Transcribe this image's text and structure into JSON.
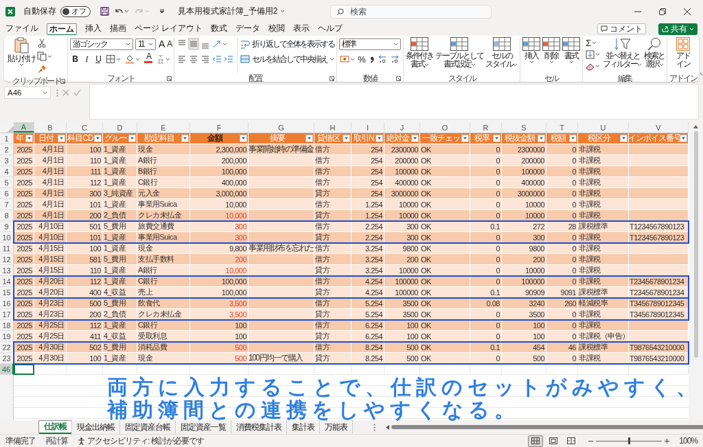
{
  "titlebar": {
    "autosave_label": "自動保存",
    "autosave_state": "オフ",
    "autosave_on": false,
    "filename": "見本用複式家計簿_予備用2",
    "search_placeholder": "検索"
  },
  "menu": [
    {
      "label": "ファイル",
      "selected": false
    },
    {
      "label": "ホーム",
      "selected": true
    },
    {
      "label": "挿入",
      "selected": false
    },
    {
      "label": "描画",
      "selected": false
    },
    {
      "label": "ページ レイアウト",
      "selected": false
    },
    {
      "label": "数式",
      "selected": false
    },
    {
      "label": "データ",
      "selected": false
    },
    {
      "label": "校閲",
      "selected": false
    },
    {
      "label": "表示",
      "selected": false
    },
    {
      "label": "ヘルプ",
      "selected": false
    }
  ],
  "comment_button": "コメント",
  "share_button": "共有",
  "ribbon": {
    "clipboard": {
      "paste": "貼り付け",
      "label": "クリップボード"
    },
    "font": {
      "name": "游ゴシック",
      "size": "11",
      "grow": "A",
      "shrink": "A",
      "bold": "B",
      "italic": "I",
      "underline": "U",
      "font_color_letter": "A",
      "label": "フォント"
    },
    "alignment": {
      "wrap": "折り返して全体を表示する",
      "merge": "セルを結合して中央揃え",
      "label": "配置"
    },
    "number": {
      "format": "標準",
      "percent": "%",
      "label": "数値"
    },
    "styles": {
      "conditional": [
        "条件付き",
        "書式"
      ],
      "table": [
        "テーブルとして",
        "書式設定"
      ],
      "cell_styles": [
        "セルの",
        "スタイル"
      ],
      "label": "スタイル"
    },
    "cells": {
      "insert": "挿入",
      "delete": "削除",
      "format": "書式",
      "label": "セル"
    },
    "editing": {
      "autosum": "Σ",
      "sort": [
        "並べ替えと",
        "フィルター"
      ],
      "find": [
        "検索と",
        "選択"
      ],
      "label": "編集"
    },
    "addins": {
      "addin": [
        "アド",
        "イン"
      ],
      "label": "アドイン"
    }
  },
  "name_box": "A46",
  "sheet": {
    "columns": [
      "A",
      "B",
      "C",
      "D",
      "E",
      "F",
      "G",
      "H",
      "I",
      "J",
      "O",
      "R",
      "S",
      "T",
      "U",
      "V"
    ],
    "header_row": {
      "num": "1",
      "cells": [
        {
          "text": "年",
          "emphasis": false
        },
        {
          "text": "日付",
          "emphasis": false
        },
        {
          "text": "科目CD",
          "emphasis": false
        },
        {
          "text": "グルー",
          "emphasis": false
        },
        {
          "text": "勘定科目",
          "emphasis": false
        },
        {
          "text": "金額",
          "emphasis": true
        },
        {
          "text": "摘要",
          "emphasis": false
        },
        {
          "text": "貸借区",
          "emphasis": false
        },
        {
          "text": "取引N",
          "emphasis": false
        },
        {
          "text": "絶対金",
          "emphasis": false
        },
        {
          "text": "一致チェッ",
          "emphasis": false
        },
        {
          "text": "税率",
          "emphasis": false
        },
        {
          "text": "税抜金額",
          "emphasis": false
        },
        {
          "text": "税額",
          "emphasis": false
        },
        {
          "text": "税区分",
          "emphasis": false
        },
        {
          "text": "インボイス番号",
          "emphasis": false
        }
      ]
    },
    "blocks": [
      {
        "boxed": false,
        "rows": [
          {
            "num": "2",
            "red": false,
            "cells": [
              "2025",
              "4月1日",
              "100",
              "1_資産",
              "現金",
              "2,300,000",
              "事業開始時の準備金",
              "借方",
              "254",
              "2300000",
              "OK",
              "0",
              "2300000",
              "0",
              "非課税",
              null
            ]
          },
          {
            "num": "3",
            "red": false,
            "cells": [
              "2025",
              "4月1日",
              "110",
              "1_資産",
              "A銀行",
              "200,000",
              null,
              "借方",
              "254",
              "200000",
              "OK",
              "0",
              "200000",
              "0",
              "非課税",
              null
            ]
          },
          {
            "num": "4",
            "red": false,
            "cells": [
              "2025",
              "4月1日",
              "111",
              "1_資産",
              "B銀行",
              "100,000",
              null,
              "借方",
              "254",
              "100000",
              "OK",
              "0",
              "100000",
              "0",
              "非課税",
              null
            ]
          },
          {
            "num": "5",
            "red": false,
            "cells": [
              "2025",
              "4月1日",
              "112",
              "1_資産",
              "C銀行",
              "400,000",
              null,
              "借方",
              "254",
              "400000",
              "OK",
              "0",
              "400000",
              "0",
              "非課税",
              null
            ]
          },
          {
            "num": "6",
            "red": false,
            "cells": [
              "2025",
              "4月1日",
              "300",
              "3_純資産",
              "元入金",
              "3,000,000",
              null,
              "貸方",
              "254",
              "3000000",
              "OK",
              "0",
              "3000000",
              "0",
              "非課税",
              null
            ]
          },
          {
            "num": "7",
            "red": false,
            "cells": [
              "2025",
              "4月1日",
              "101",
              "1_資産",
              "事業用Suica",
              "10,000",
              null,
              "借方",
              "1.254",
              "10000",
              "OK",
              "0",
              "10000",
              "0",
              "非課税",
              null
            ]
          },
          {
            "num": "8",
            "red": true,
            "cells": [
              "2025",
              "4月1日",
              "200",
              "2_負債",
              "クレカ未払金",
              "10,000",
              null,
              "貸方",
              "1.254",
              "10000",
              "OK",
              "0",
              "10000",
              "0",
              "非課税",
              null
            ]
          }
        ]
      },
      {
        "boxed": true,
        "rows": [
          {
            "num": "9",
            "red": true,
            "cells": [
              "2025",
              "4月10日",
              "501",
              "5_費用",
              "旅費交通費",
              "300",
              null,
              "借方",
              "2.254",
              "300",
              "OK",
              "0.1",
              "272",
              "28",
              "課税標準",
              "T1234567890123"
            ]
          },
          {
            "num": "10",
            "red": true,
            "cells": [
              "2025",
              "4月10日",
              "101",
              "1_資産",
              "事業用Suica",
              "300",
              null,
              "貸方",
              "2.254",
              "300",
              "OK",
              "0",
              "300",
              "0",
              "非課税",
              "T1234567890123"
            ]
          }
        ]
      },
      {
        "boxed": false,
        "rows": [
          {
            "num": "11",
            "red": false,
            "cells": [
              "2025",
              "4月15日",
              "100",
              "1_資産",
              "現金",
              "9,800",
              "事業用財布を忘れた",
              "借方",
              "3.254",
              "9800",
              "OK",
              "0",
              "9800",
              "0",
              "非課税",
              null
            ]
          },
          {
            "num": "12",
            "red": true,
            "cells": [
              "2025",
              "4月15日",
              "581",
              "5_費用",
              "支払手数料",
              "200",
              null,
              "借方",
              "3.254",
              "200",
              "OK",
              "0",
              "200",
              "0",
              "非課税",
              null
            ]
          },
          {
            "num": "13",
            "red": true,
            "cells": [
              "2025",
              "4月15日",
              "110",
              "1_資産",
              "A銀行",
              "10,000",
              null,
              "貸方",
              "3.254",
              "10000",
              "OK",
              "0",
              "10000",
              "0",
              "非課税",
              null
            ]
          }
        ]
      },
      {
        "boxed": true,
        "rows": [
          {
            "num": "14",
            "red": false,
            "cells": [
              "2025",
              "4月20日",
              "112",
              "1_資産",
              "C銀行",
              "100,000",
              null,
              "借方",
              "4.254",
              "100000",
              "OK",
              "0",
              "100000",
              "0",
              "非課税",
              "T2345678901234"
            ]
          },
          {
            "num": "15",
            "red": false,
            "cells": [
              "2025",
              "4月20日",
              "400",
              "4_収益",
              "売上",
              "100,000",
              null,
              "貸方",
              "4.254",
              "100000",
              "OK",
              "0.1",
              "90909",
              "9091",
              "課税標準",
              "T2345678901234"
            ]
          }
        ]
      },
      {
        "boxed": true,
        "rows": [
          {
            "num": "16",
            "red": true,
            "cells": [
              "2025",
              "4月23日",
              "500",
              "5_費用",
              "飲食代",
              "3,500",
              null,
              "借方",
              "5.254",
              "3500",
              "OK",
              "0.08",
              "3240",
              "260",
              "軽減税率",
              "T3456789012345"
            ]
          },
          {
            "num": "17",
            "red": true,
            "cells": [
              "2025",
              "4月23日",
              "200",
              "2_負債",
              "クレカ未払金",
              "3,500",
              null,
              "貸方",
              "5.254",
              "3500",
              "OK",
              "0",
              "3500",
              "0",
              "非課税",
              "T3456789012345"
            ]
          }
        ]
      },
      {
        "boxed": false,
        "rows": [
          {
            "num": "18",
            "red": false,
            "cells": [
              "2025",
              "4月25日",
              "112",
              "1_資産",
              "C銀行",
              "100",
              null,
              "借方",
              "6.254",
              "100",
              "OK",
              "0",
              "100",
              "0",
              "非課税",
              null
            ]
          },
          {
            "num": "19",
            "red": false,
            "cells": [
              "2025",
              "4月25日",
              "411",
              "4_収益",
              "受取利息",
              "100",
              null,
              "貸方",
              "6.254",
              "100",
              "OK",
              "0",
              "100",
              "0",
              "非課税（申告）",
              null
            ]
          }
        ]
      },
      {
        "boxed": true,
        "rows": [
          {
            "num": "22",
            "red": true,
            "cells": [
              "2025",
              "4月30日",
              "502",
              "5_費用",
              "消耗品費",
              "500",
              null,
              "借方",
              "8.254",
              "500",
              "OK",
              "0.1",
              "454",
              "46",
              "課税標準",
              "T9876543210000"
            ]
          },
          {
            "num": "23",
            "red": true,
            "cells": [
              "2025",
              "4月30日",
              "100",
              "1_資産",
              "現金",
              "500",
              "100円均一で購入",
              "貸方",
              "8.254",
              "500",
              "OK",
              "0",
              "500",
              "0",
              "非課税",
              "T9876543210000"
            ]
          }
        ]
      }
    ],
    "last_row": {
      "num": "46",
      "active_cell": true
    }
  },
  "annotation": [
    "両方に入力することで、仕訳のセットがみやすく、",
    "補助簿間との連携をしやすくなる。"
  ],
  "sheet_tabs": [
    {
      "label": "仕訳帳",
      "selected": true
    },
    {
      "label": "現金出納帳",
      "selected": false
    },
    {
      "label": "固定資産台帳",
      "selected": false
    },
    {
      "label": "固定資産一覧",
      "selected": false
    },
    {
      "label": "消費税集計表",
      "selected": false
    },
    {
      "label": "集計表",
      "selected": false
    },
    {
      "label": "万能表",
      "selected": false
    }
  ],
  "status": {
    "ready": "準備完了",
    "recalc": "再計算",
    "accessibility": "アクセシビリティ: 検討が必要です",
    "views": [
      {
        "selected": true
      },
      {
        "selected": false
      },
      {
        "selected": false
      }
    ],
    "zoom_slider": {
      "level": 0.5
    },
    "zoom": "100%"
  }
}
